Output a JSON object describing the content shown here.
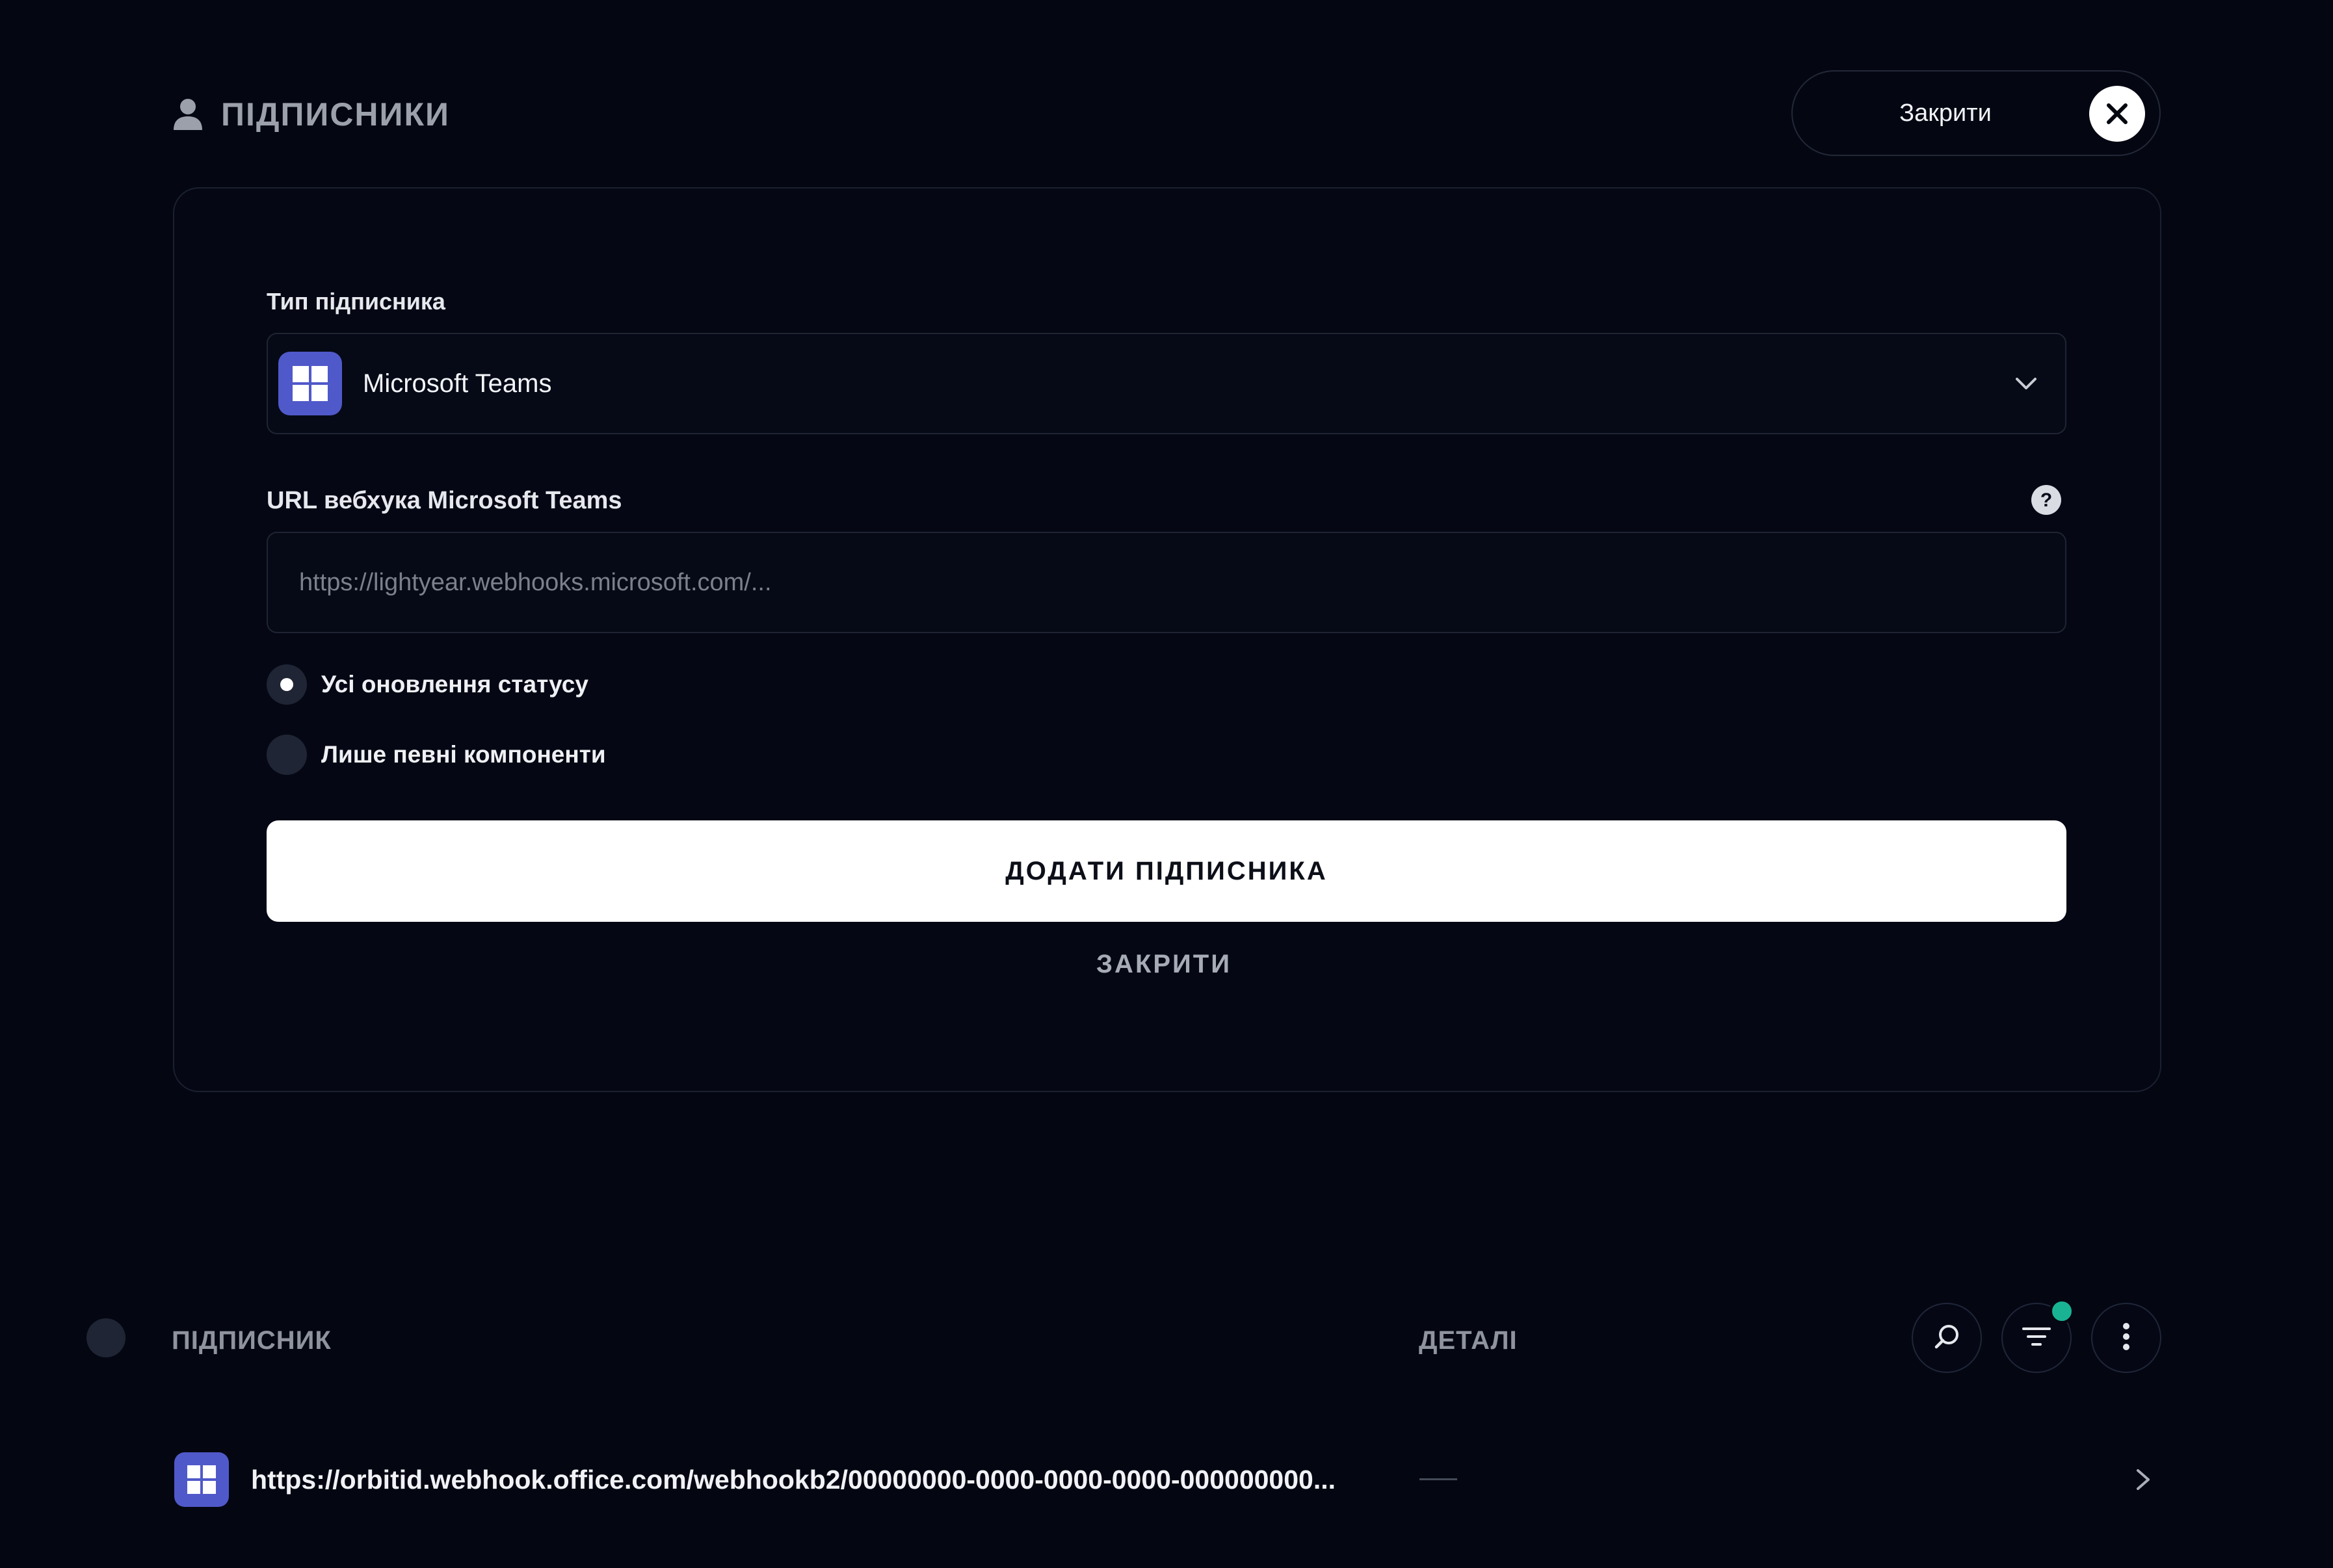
{
  "header": {
    "title": "ПІДПИСНИКИ",
    "close_label": "Закрити"
  },
  "form": {
    "type_label": "Тип підписника",
    "type_value": "Microsoft Teams",
    "url_label": "URL вебхука Microsoft Teams",
    "url_value": "",
    "url_placeholder": "https://lightyear.webhooks.microsoft.com/...",
    "radio_options": [
      {
        "label": "Усі оновлення статусу",
        "checked": true
      },
      {
        "label": "Лише певні компоненти",
        "checked": false
      }
    ],
    "submit_label": "ДОДАТИ ПІДПИСНИКА",
    "cancel_label": "ЗАКРИТИ"
  },
  "table": {
    "columns": [
      "ПІДПИСНИК",
      "ДЕТАЛІ"
    ],
    "rows": [
      {
        "url": "https://orbitid.webhook.office.com/webhookb2/00000000-0000-0000-0000-000000000...",
        "details": ""
      }
    ]
  },
  "colors": {
    "background": "#040712",
    "teams_brand": "#5059c9",
    "notification": "#19b394"
  },
  "icons": [
    "user-icon",
    "close-icon",
    "microsoft-teams-icon",
    "chevron-down-icon",
    "help-icon",
    "search-icon",
    "filter-icon",
    "more-vertical-icon",
    "chevron-right-icon"
  ]
}
